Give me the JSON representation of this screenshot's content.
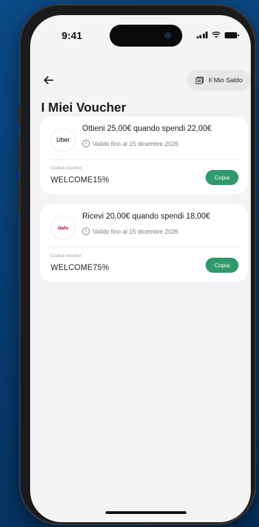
{
  "status_bar": {
    "time": "9:41"
  },
  "header": {
    "back_icon": "arrow-left-icon",
    "saldo_icon": "wallet-icon",
    "saldo_label": "Il Mio Saldo"
  },
  "page": {
    "title": "I Miei Voucher"
  },
  "vouchers": [
    {
      "brand": "Uber",
      "offer": "Ottieni 25,00€ quando spendi 22,00€",
      "validity": "Valido fino al 15 dicembre 2026",
      "code_label": "Codice voucher",
      "code": "WELCOME15%",
      "copy_label": "Copia"
    },
    {
      "brand": "italo",
      "offer": "Ricevi 20,00€ quando spendi 18,00€",
      "validity": "Valido fino al 15 dicembre 2026",
      "code_label": "Codice voucher",
      "code": "WELCOME75%",
      "copy_label": "Copia"
    }
  ],
  "colors": {
    "accent": "#2f9a6b",
    "background": "#0b4a86",
    "screen": "#f4f4f4"
  }
}
